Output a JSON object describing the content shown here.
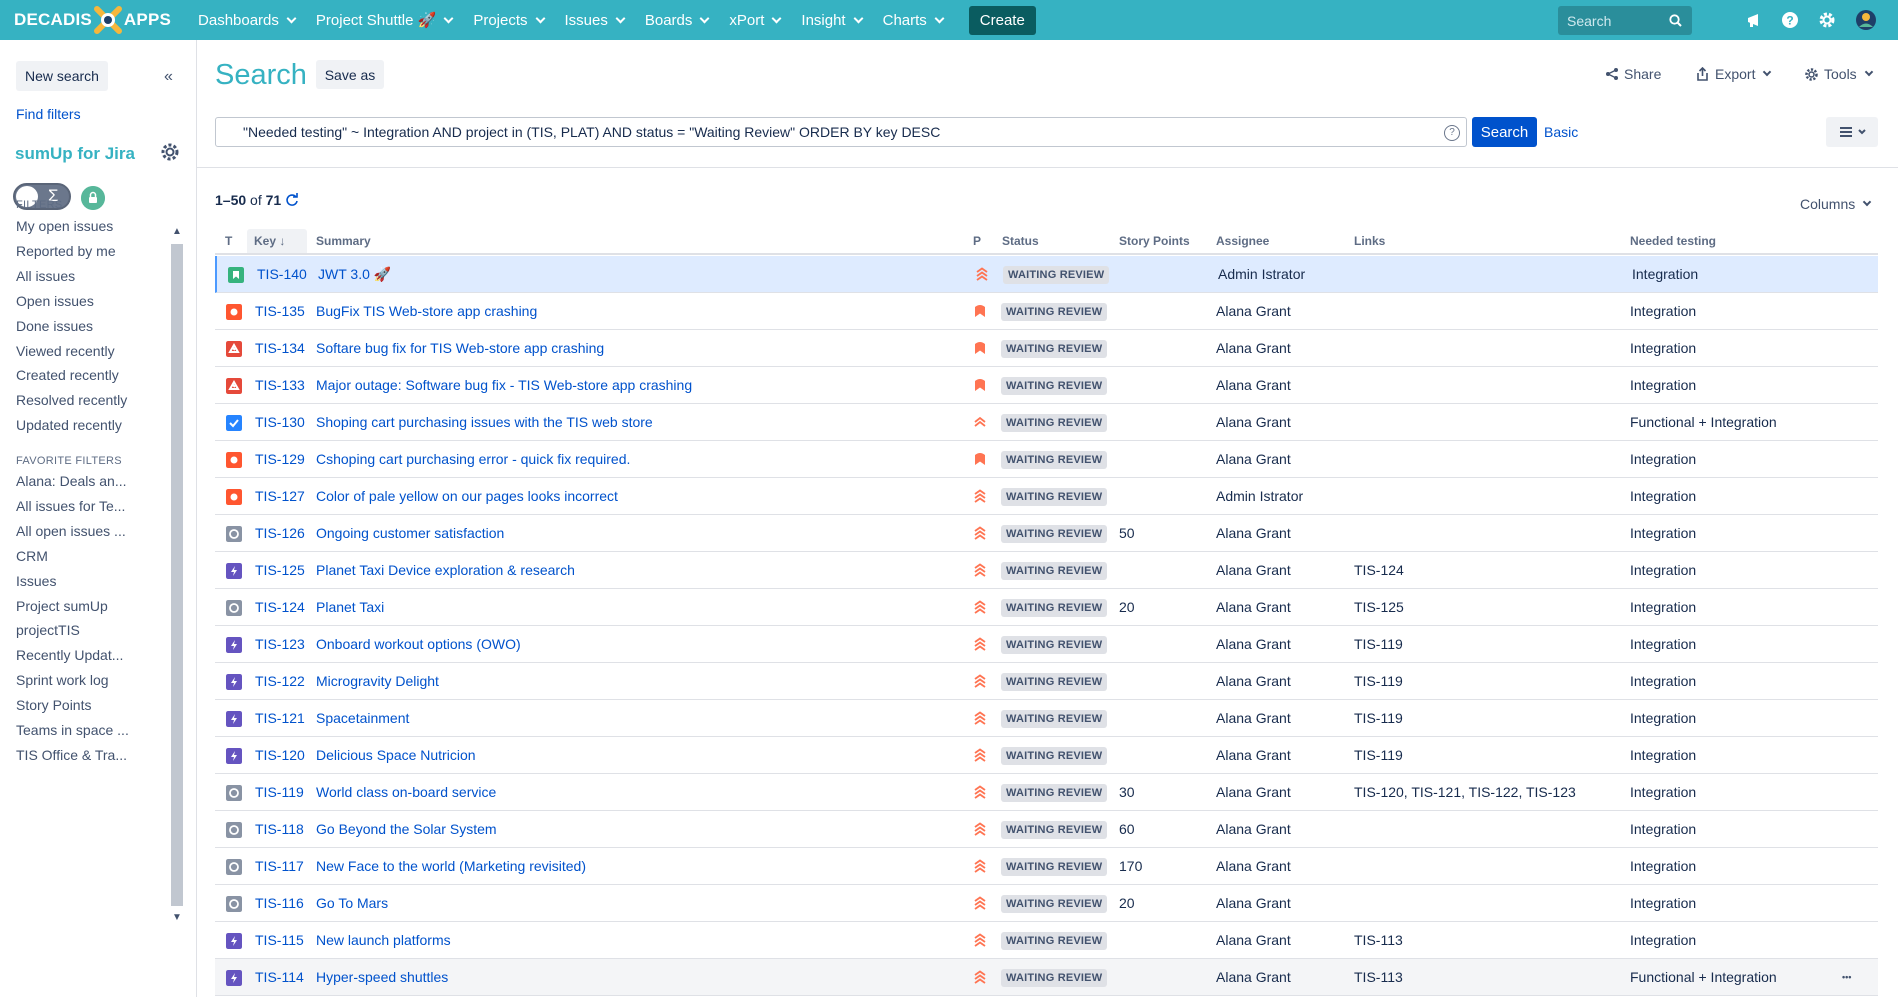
{
  "topnav": {
    "logo_left": "DECADIS",
    "logo_right": "APPS",
    "items": [
      {
        "label": "Dashboards"
      },
      {
        "label": "Project Shuttle 🚀"
      },
      {
        "label": "Projects"
      },
      {
        "label": "Issues"
      },
      {
        "label": "Boards"
      },
      {
        "label": "xPort"
      },
      {
        "label": "Insight"
      },
      {
        "label": "Charts"
      }
    ],
    "create_label": "Create",
    "search_placeholder": "Search"
  },
  "sidebar": {
    "new_search": "New search",
    "find_filters": "Find filters",
    "sumup_title": "sumUp for Jira",
    "toggle_symbol": "Σ",
    "filters_heading": "FILTERS",
    "filters": [
      "My open issues",
      "Reported by me",
      "All issues",
      "Open issues",
      "Done issues",
      "Viewed recently",
      "Created recently",
      "Resolved recently",
      "Updated recently"
    ],
    "favorites_heading": "FAVORITE FILTERS",
    "favorites": [
      "Alana: Deals an...",
      "All issues for Te...",
      "All open issues ...",
      "CRM",
      "Issues",
      "Project sumUp",
      "projectTIS",
      "Recently Updat...",
      "Sprint work log",
      "Story Points",
      "Teams in space ...",
      "TIS Office & Tra..."
    ]
  },
  "header": {
    "title": "Search",
    "save_as": "Save as",
    "share": "Share",
    "export": "Export",
    "tools": "Tools"
  },
  "query": {
    "jql": "\"Needed testing\" ~ Integration AND project in (TIS, PLAT) AND status = \"Waiting Review\" ORDER BY key DESC",
    "search_button": "Search",
    "basic_link": "Basic"
  },
  "results": {
    "range": "1–50",
    "of": "of",
    "total": "71",
    "columns_label": "Columns"
  },
  "table": {
    "headers": {
      "t": "T",
      "key": "Key",
      "summary": "Summary",
      "p": "P",
      "status": "Status",
      "story_points": "Story Points",
      "assignee": "Assignee",
      "links": "Links",
      "needed": "Needed testing"
    },
    "rows": [
      {
        "type": "story",
        "key": "TIS-140",
        "summary": "JWT 3.0 🚀",
        "priority": "highest",
        "status": "WAITING REVIEW",
        "sp": "",
        "assignee": "Admin Istrator",
        "links": "",
        "needed": "Integration"
      },
      {
        "type": "bug",
        "key": "TIS-135",
        "summary": "BugFix TIS Web-store app crashing",
        "priority": "blocker",
        "status": "WAITING REVIEW",
        "sp": "",
        "assignee": "Alana Grant",
        "links": "",
        "needed": "Integration"
      },
      {
        "type": "incident",
        "key": "TIS-134",
        "summary": "Softare bug fix for TIS Web-store app crashing",
        "priority": "blocker",
        "status": "WAITING REVIEW",
        "sp": "",
        "assignee": "Alana Grant",
        "links": "",
        "needed": "Integration"
      },
      {
        "type": "incident",
        "key": "TIS-133",
        "summary": "Major outage: Software bug fix - TIS Web-store app crashing",
        "priority": "blocker",
        "status": "WAITING REVIEW",
        "sp": "",
        "assignee": "Alana Grant",
        "links": "",
        "needed": "Integration"
      },
      {
        "type": "task",
        "key": "TIS-130",
        "summary": "Shoping cart purchasing issues with the TIS web store",
        "priority": "high",
        "status": "WAITING REVIEW",
        "sp": "",
        "assignee": "Alana Grant",
        "links": "",
        "needed": "Functional + Integration"
      },
      {
        "type": "bug",
        "key": "TIS-129",
        "summary": "Cshoping cart purchasing error - quick fix required.",
        "priority": "blocker",
        "status": "WAITING REVIEW",
        "sp": "",
        "assignee": "Alana Grant",
        "links": "",
        "needed": "Integration"
      },
      {
        "type": "bug",
        "key": "TIS-127",
        "summary": "Color of pale yellow on our pages looks incorrect",
        "priority": "highest",
        "status": "WAITING REVIEW",
        "sp": "",
        "assignee": "Admin Istrator",
        "links": "",
        "needed": "Integration"
      },
      {
        "type": "sub",
        "key": "TIS-126",
        "summary": "Ongoing customer satisfaction",
        "priority": "highest",
        "status": "WAITING REVIEW",
        "sp": "50",
        "assignee": "Alana Grant",
        "links": "",
        "needed": "Integration"
      },
      {
        "type": "epic",
        "key": "TIS-125",
        "summary": "Planet Taxi Device exploration & research",
        "priority": "highest",
        "status": "WAITING REVIEW",
        "sp": "",
        "assignee": "Alana Grant",
        "links": "TIS-124",
        "needed": "Integration"
      },
      {
        "type": "sub",
        "key": "TIS-124",
        "summary": "Planet Taxi",
        "priority": "highest",
        "status": "WAITING REVIEW",
        "sp": "20",
        "assignee": "Alana Grant",
        "links": "TIS-125",
        "needed": "Integration"
      },
      {
        "type": "epic",
        "key": "TIS-123",
        "summary": "Onboard workout options (OWO)",
        "priority": "highest",
        "status": "WAITING REVIEW",
        "sp": "",
        "assignee": "Alana Grant",
        "links": "TIS-119",
        "needed": "Integration"
      },
      {
        "type": "epic",
        "key": "TIS-122",
        "summary": "Microgravity Delight",
        "priority": "highest",
        "status": "WAITING REVIEW",
        "sp": "",
        "assignee": "Alana Grant",
        "links": "TIS-119",
        "needed": "Integration"
      },
      {
        "type": "epic",
        "key": "TIS-121",
        "summary": "Spacetainment",
        "priority": "highest",
        "status": "WAITING REVIEW",
        "sp": "",
        "assignee": "Alana Grant",
        "links": "TIS-119",
        "needed": "Integration"
      },
      {
        "type": "epic",
        "key": "TIS-120",
        "summary": "Delicious Space Nutricion",
        "priority": "highest",
        "status": "WAITING REVIEW",
        "sp": "",
        "assignee": "Alana Grant",
        "links": "TIS-119",
        "needed": "Integration"
      },
      {
        "type": "sub",
        "key": "TIS-119",
        "summary": "World class on-board service",
        "priority": "highest",
        "status": "WAITING REVIEW",
        "sp": "30",
        "assignee": "Alana Grant",
        "links": "TIS-120, TIS-121, TIS-122, TIS-123",
        "needed": "Integration"
      },
      {
        "type": "sub",
        "key": "TIS-118",
        "summary": "Go Beyond the Solar System",
        "priority": "highest",
        "status": "WAITING REVIEW",
        "sp": "60",
        "assignee": "Alana Grant",
        "links": "",
        "needed": "Integration"
      },
      {
        "type": "sub",
        "key": "TIS-117",
        "summary": "New Face to the world (Marketing revisited)",
        "priority": "highest",
        "status": "WAITING REVIEW",
        "sp": "170",
        "assignee": "Alana Grant",
        "links": "",
        "needed": "Integration"
      },
      {
        "type": "sub",
        "key": "TIS-116",
        "summary": "Go To Mars",
        "priority": "highest",
        "status": "WAITING REVIEW",
        "sp": "20",
        "assignee": "Alana Grant",
        "links": "",
        "needed": "Integration"
      },
      {
        "type": "epic",
        "key": "TIS-115",
        "summary": "New launch platforms",
        "priority": "highest",
        "status": "WAITING REVIEW",
        "sp": "",
        "assignee": "Alana Grant",
        "links": "TIS-113",
        "needed": "Integration"
      },
      {
        "type": "epic",
        "key": "TIS-114",
        "summary": "Hyper-speed shuttles",
        "priority": "highest",
        "status": "WAITING REVIEW",
        "sp": "",
        "assignee": "Alana Grant",
        "links": "TIS-113",
        "needed": "Functional + Integration"
      }
    ]
  },
  "colors": {
    "brand": "#36b2c2",
    "link": "#0052cc",
    "story": "#36b37e",
    "bug": "#ff5630",
    "incident": "#e5493a",
    "task": "#2684ff",
    "sub": "#8993a4",
    "epic": "#6554c0",
    "priority": "#ff7452"
  }
}
